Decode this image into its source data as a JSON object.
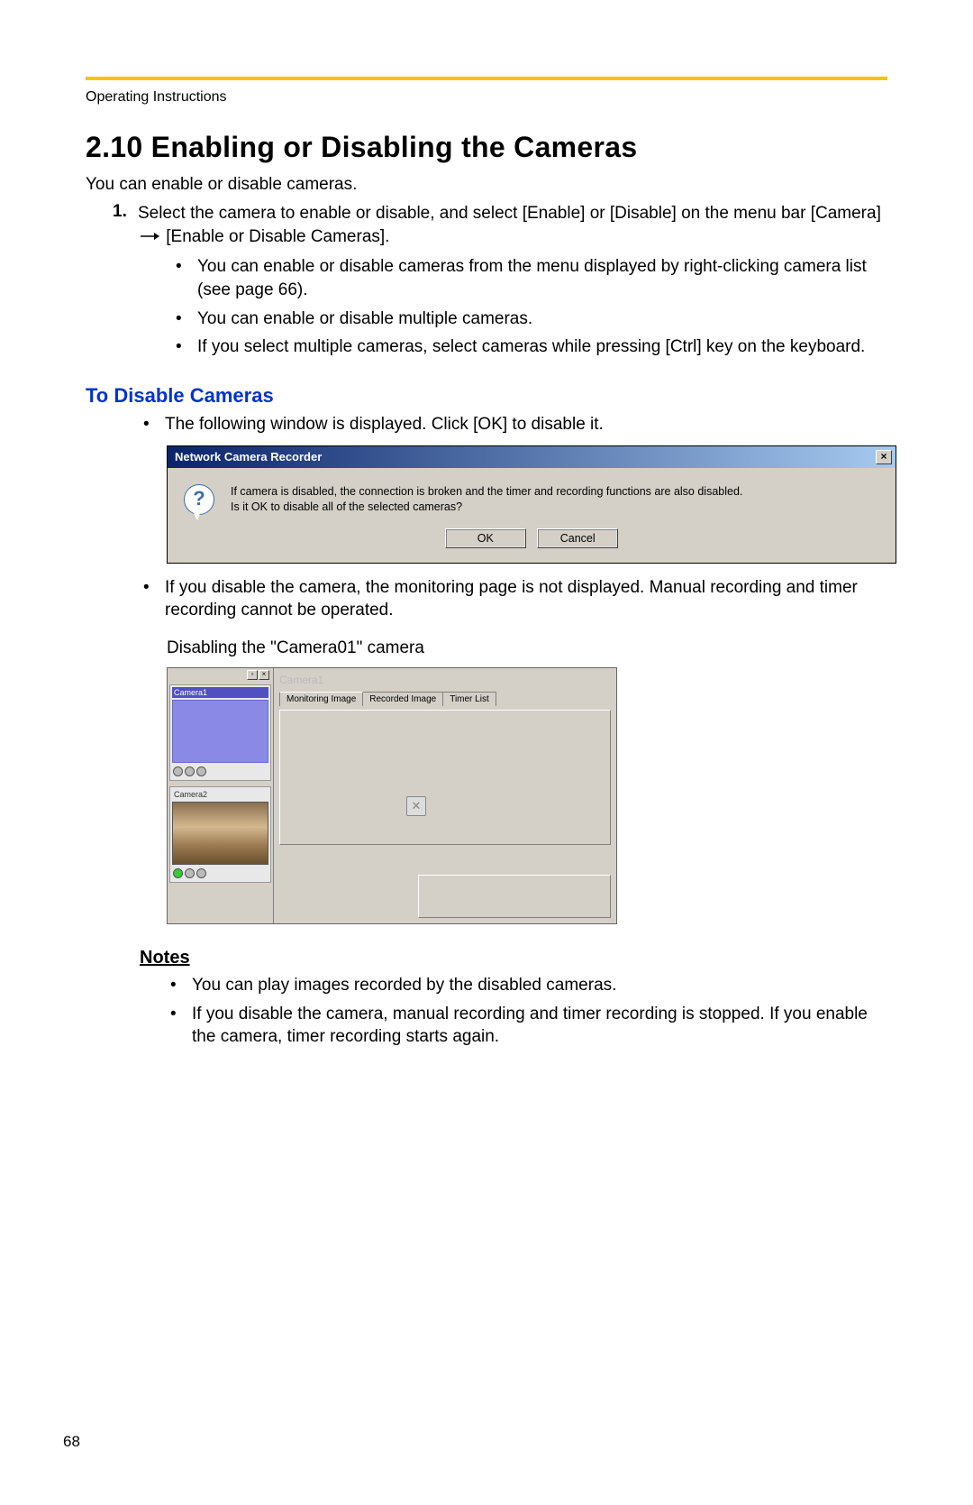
{
  "header": "Operating Instructions",
  "title": "2.10  Enabling or Disabling the Cameras",
  "intro": "You can enable or disable cameras.",
  "step1_num": "1.",
  "step1_text_a": "Select the camera to enable or disable, and select [Enable] or [Disable] on the menu bar [Camera]",
  "step1_text_b": "[Enable or Disable Cameras].",
  "inner_bullets": [
    "You can enable or disable cameras from the menu displayed by right-clicking camera list (see page 66).",
    "You can enable or disable multiple cameras.",
    "If you select multiple cameras, select cameras while pressing [Ctrl] key on the keyboard."
  ],
  "blue_heading": "To Disable Cameras",
  "disable_bullets_pre": "The following window is displayed. Click [OK] to disable it.",
  "disable_bullets_post": "If you disable the camera, the monitoring page is not displayed. Manual recording and timer recording cannot be operated.",
  "dialog": {
    "title": "Network Camera Recorder",
    "line1": "If camera is disabled, the connection is broken and the timer and recording functions are also disabled.",
    "line2": "Is it OK to disable all of the selected cameras?",
    "ok": "OK",
    "cancel": "Cancel",
    "close_x": "×",
    "q_mark": "?"
  },
  "caption": "Disabling the \"Camera01\" camera",
  "app": {
    "camera1": "Camera1",
    "camera2": "Camera2",
    "faded": "Camera1",
    "tab1": "Monitoring Image",
    "tab2": "Recorded Image",
    "tab3": "Timer List",
    "x_icon": "✕"
  },
  "notes_heading": "Notes",
  "notes": [
    "You can play images recorded by the disabled cameras.",
    "If you disable the camera, manual recording and timer recording is stopped. If you enable the camera, timer recording starts again."
  ],
  "page_num": "68"
}
